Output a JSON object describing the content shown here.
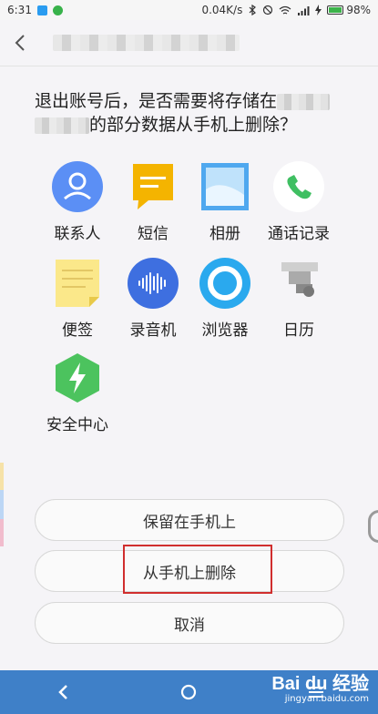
{
  "status_bar": {
    "time": "6:31",
    "net_speed": "0.04K/s",
    "battery": "98%",
    "battery_level": 0.98
  },
  "header": {
    "back_icon": "chevron-left-icon"
  },
  "question": {
    "part1": "退出账号后，是否需要将存储在",
    "part2": "的部分数据从手机上删除？"
  },
  "apps": [
    {
      "label": "联系人",
      "icon": "contacts-icon",
      "color": "#5b8ff5"
    },
    {
      "label": "短信",
      "icon": "messages-icon",
      "color": "#f4b400"
    },
    {
      "label": "相册",
      "icon": "gallery-icon",
      "color": "#4fa8ef"
    },
    {
      "label": "通话记录",
      "icon": "phone-icon",
      "color": "#3fbf62"
    },
    {
      "label": "便签",
      "icon": "notes-icon",
      "color": "#fbe88a"
    },
    {
      "label": "录音机",
      "icon": "recorder-icon",
      "color": "#3e6fe0"
    },
    {
      "label": "浏览器",
      "icon": "browser-icon",
      "color": "#2aa9ee"
    },
    {
      "label": "日历",
      "icon": "calendar-icon",
      "color": "#9a9a9a"
    },
    {
      "label": "安全中心",
      "icon": "security-icon",
      "color": "#4cc35e"
    }
  ],
  "buttons": {
    "keep": "保留在手机上",
    "delete": "从手机上删除",
    "cancel": "取消"
  },
  "watermark": {
    "brand": "Bai du 经验",
    "url": "jingyan.baidu.com"
  },
  "colors": {
    "nav_bar": "#3f80c8",
    "highlight": "#d02e2e"
  }
}
